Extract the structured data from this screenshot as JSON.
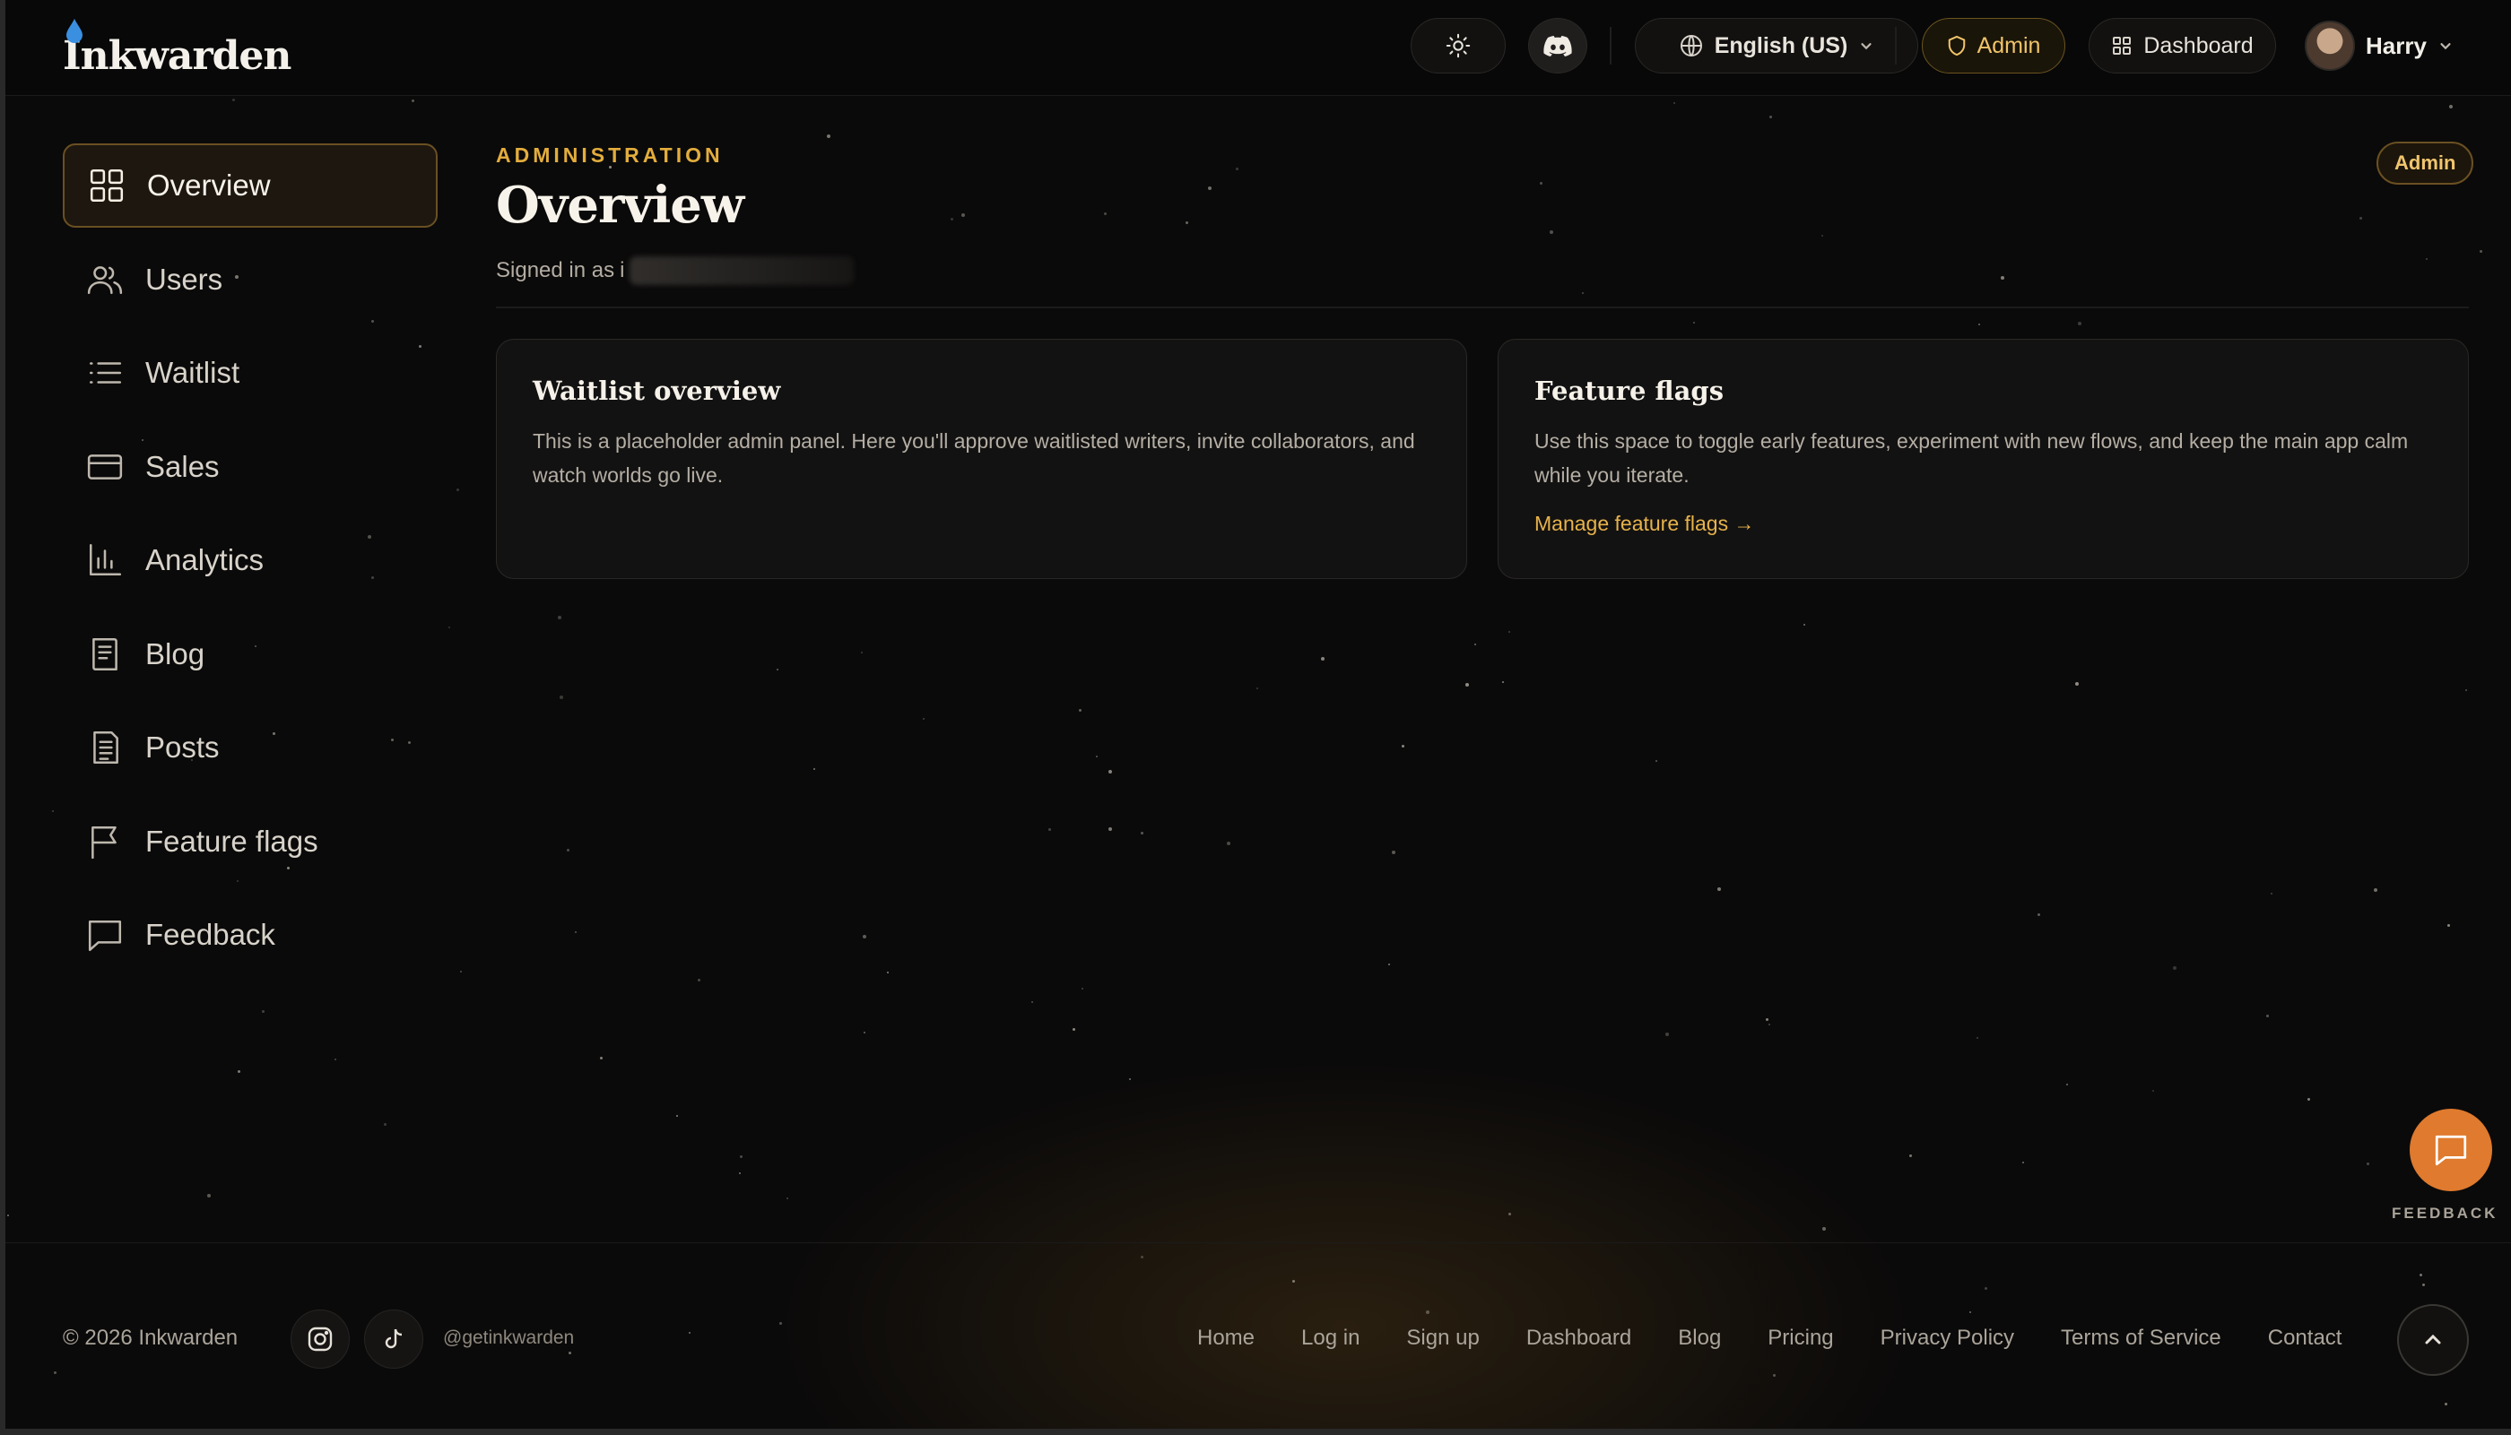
{
  "app": {
    "brand": "Inkwarden"
  },
  "header": {
    "language_label": "English (US)",
    "admin_label": "Admin",
    "dashboard_label": "Dashboard",
    "user_name": "Harry"
  },
  "sidebar": {
    "items": [
      {
        "label": "Overview",
        "icon": "grid-icon",
        "active": true
      },
      {
        "label": "Users",
        "icon": "users-icon",
        "active": false
      },
      {
        "label": "Waitlist",
        "icon": "list-icon",
        "active": false
      },
      {
        "label": "Sales",
        "icon": "credit-card-icon",
        "active": false
      },
      {
        "label": "Analytics",
        "icon": "bar-chart-icon",
        "active": false
      },
      {
        "label": "Blog",
        "icon": "book-icon",
        "active": false
      },
      {
        "label": "Posts",
        "icon": "document-icon",
        "active": false
      },
      {
        "label": "Feature flags",
        "icon": "flag-icon",
        "active": false
      },
      {
        "label": "Feedback",
        "icon": "message-icon",
        "active": false
      }
    ]
  },
  "main": {
    "eyebrow": "ADMINISTRATION",
    "title": "Overview",
    "signed_in_prefix": "Signed in as",
    "signed_in_visible": "i",
    "role_badge": "Admin",
    "cards": [
      {
        "title": "Waitlist overview",
        "body": "This is a placeholder admin panel. Here you'll approve waitlisted writers, invite collaborators, and watch worlds go live.",
        "link": ""
      },
      {
        "title": "Feature flags",
        "body": "Use this space to toggle early features, experiment with new flows, and keep the main app calm while you iterate.",
        "link": "Manage feature flags →"
      }
    ]
  },
  "fab": {
    "label": "FEEDBACK"
  },
  "footer": {
    "copyright": "© 2026 Inkwarden",
    "handle": "@getinkwarden",
    "links": [
      "Home",
      "Log in",
      "Sign up",
      "Dashboard",
      "Blog",
      "Pricing",
      "Privacy Policy",
      "Terms of Service",
      "Contact"
    ]
  },
  "colors": {
    "accent": "#e3ad3d",
    "background": "#0b0a0a",
    "fab": "#df7a2e"
  }
}
